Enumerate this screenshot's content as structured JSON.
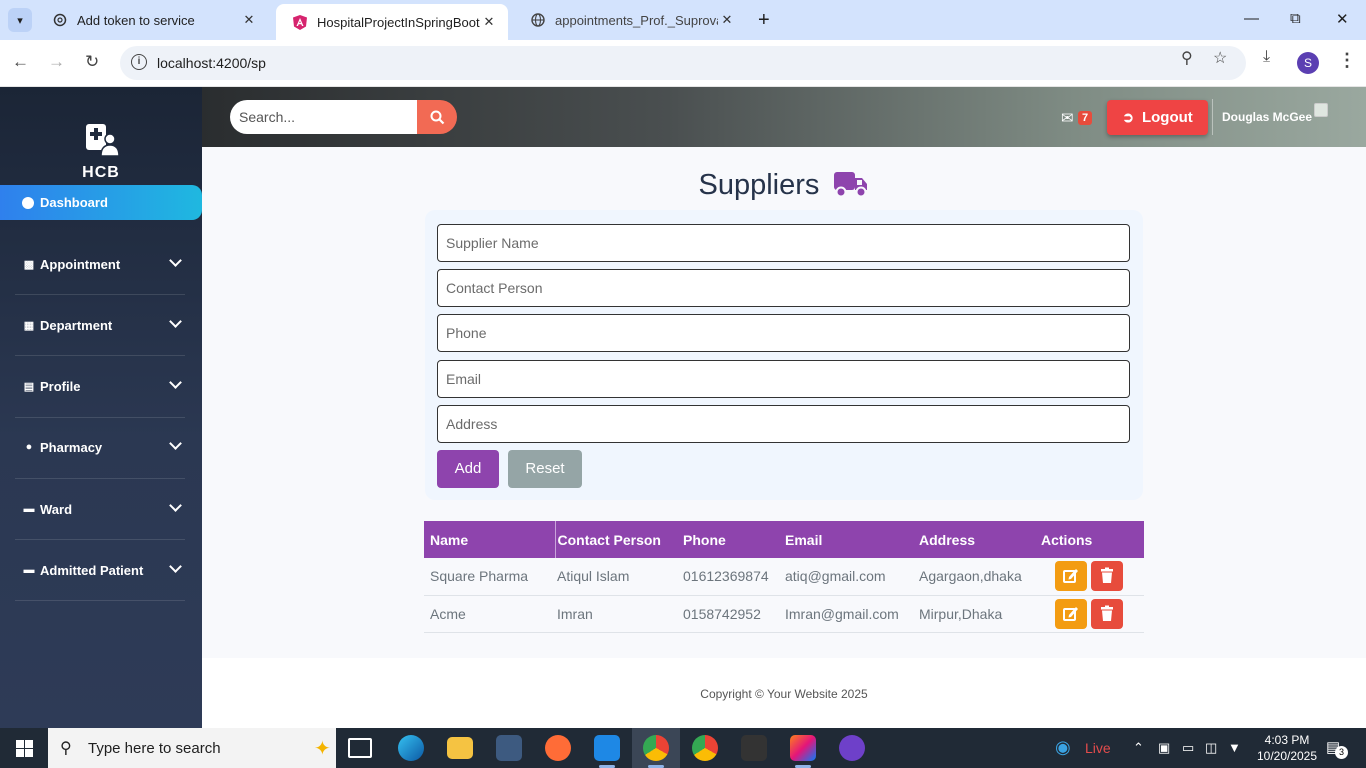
{
  "browser": {
    "tabs": [
      {
        "title": "Add token to service",
        "active": false
      },
      {
        "title": "HospitalProjectInSpringBoot",
        "active": true
      },
      {
        "title": "appointments_Prof._Suprova_S",
        "active": false
      }
    ],
    "url": "localhost:4200/sp",
    "profile_initial": "S"
  },
  "sidebar": {
    "logo_text": "HCB",
    "active_item": "Dashboard",
    "items": [
      {
        "label": "Appointment",
        "icon": "calendar-icon"
      },
      {
        "label": "Department",
        "icon": "building-icon"
      },
      {
        "label": "Profile",
        "icon": "id-card-icon"
      },
      {
        "label": "Pharmacy",
        "icon": "pills-icon"
      },
      {
        "label": "Ward",
        "icon": "bed-icon"
      },
      {
        "label": "Admitted Patient",
        "icon": "bed-icon"
      }
    ]
  },
  "topbar": {
    "search_placeholder": "Search...",
    "mail_count": "7",
    "logout_label": "Logout",
    "user_name": "Douglas McGee"
  },
  "page": {
    "title": "Suppliers",
    "form": {
      "supplier_name_placeholder": "Supplier Name",
      "contact_person_placeholder": "Contact Person",
      "phone_placeholder": "Phone",
      "email_placeholder": "Email",
      "address_placeholder": "Address",
      "add_label": "Add",
      "reset_label": "Reset"
    },
    "table": {
      "headers": [
        "Name",
        "Contact Person",
        "Phone",
        "Email",
        "Address",
        "Actions"
      ],
      "rows": [
        [
          "Square Pharma",
          "Atiqul Islam",
          "01612369874",
          "atiq@gmail.com",
          "Agargaon,dhaka"
        ],
        [
          "Acme",
          "Imran",
          "0158742952",
          "Imran@gmail.com",
          "Mirpur,Dhaka"
        ]
      ]
    },
    "footer": "Copyright © Your Website 2025"
  },
  "taskbar": {
    "search_text": "Type here to search",
    "live_label": "Live",
    "time": "4:03 PM",
    "date": "10/20/2025",
    "notifications": "3"
  },
  "colors": {
    "accent_purple": "#8e44ad",
    "logout_red": "#ef4444",
    "edit_orange": "#f39c12",
    "delete_red": "#e74c3c",
    "dashboard_blue": "#2f80ed"
  }
}
